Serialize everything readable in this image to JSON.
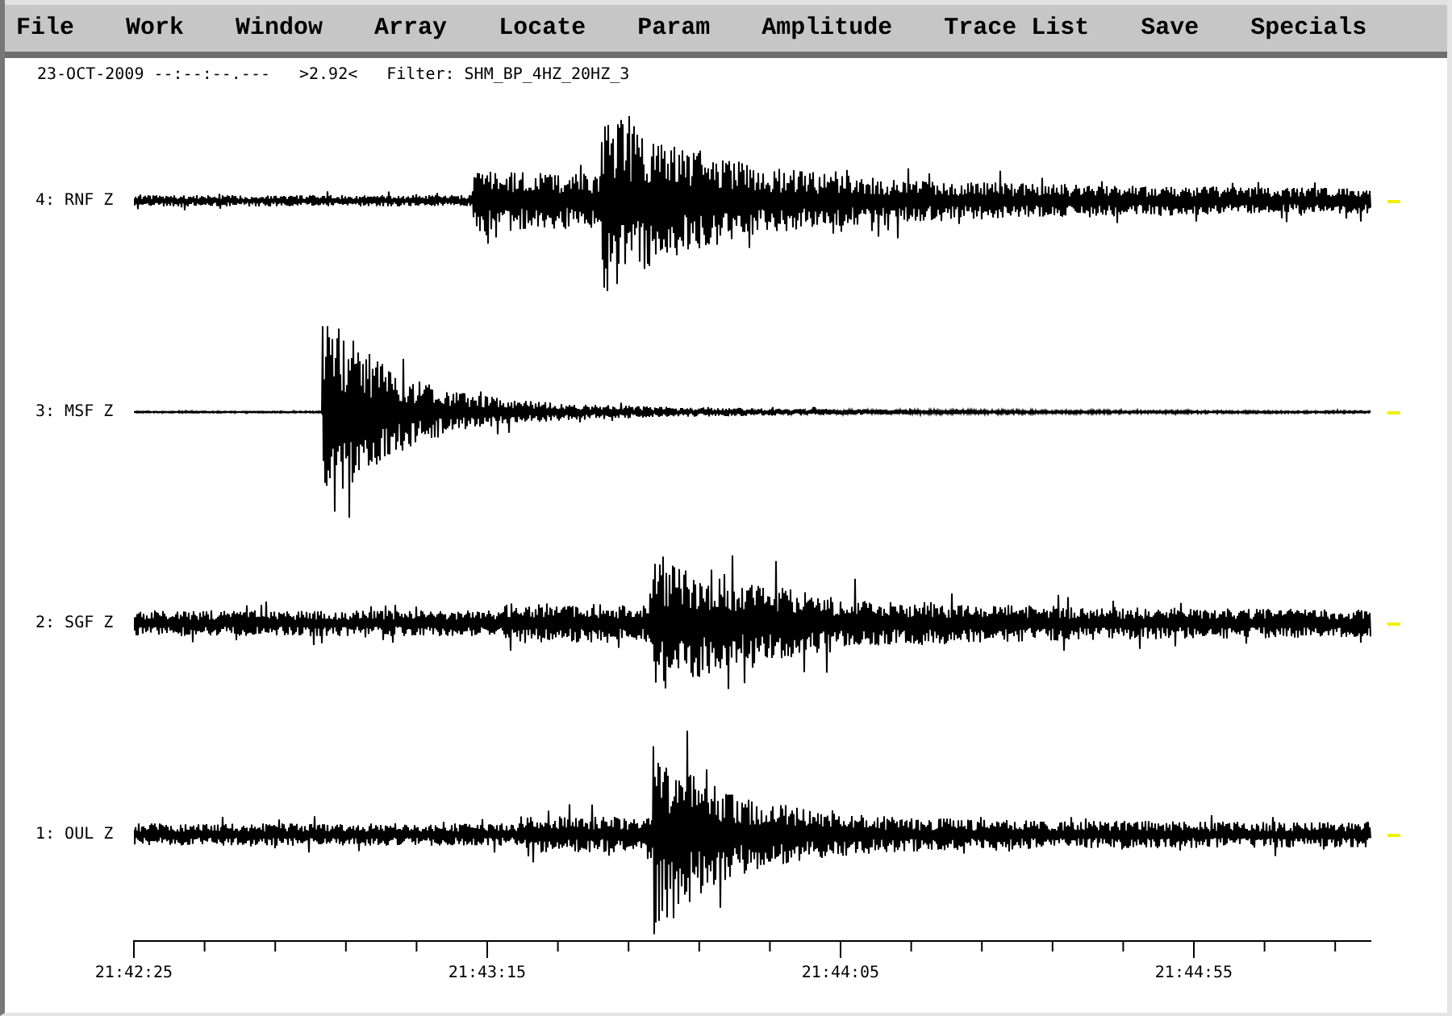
{
  "menu": [
    "File",
    "Work",
    "Window",
    "Array",
    "Locate",
    "Param",
    "Amplitude",
    "Trace List",
    "Save",
    "Specials"
  ],
  "header": {
    "time": "23-OCT-2009 --:--:--.---",
    "scale": ">2.92<",
    "filter": "Filter: SHM_BP_4HZ_20HZ_3"
  },
  "traces": [
    {
      "label": "4: RNF Z"
    },
    {
      "label": "3: MSF Z"
    },
    {
      "label": "2: SGF Z"
    },
    {
      "label": "1: OUL Z"
    }
  ],
  "time_axis": {
    "ticks": [
      "21:42:25",
      "21:43:15",
      "21:44:05",
      "21:44:55"
    ]
  }
}
